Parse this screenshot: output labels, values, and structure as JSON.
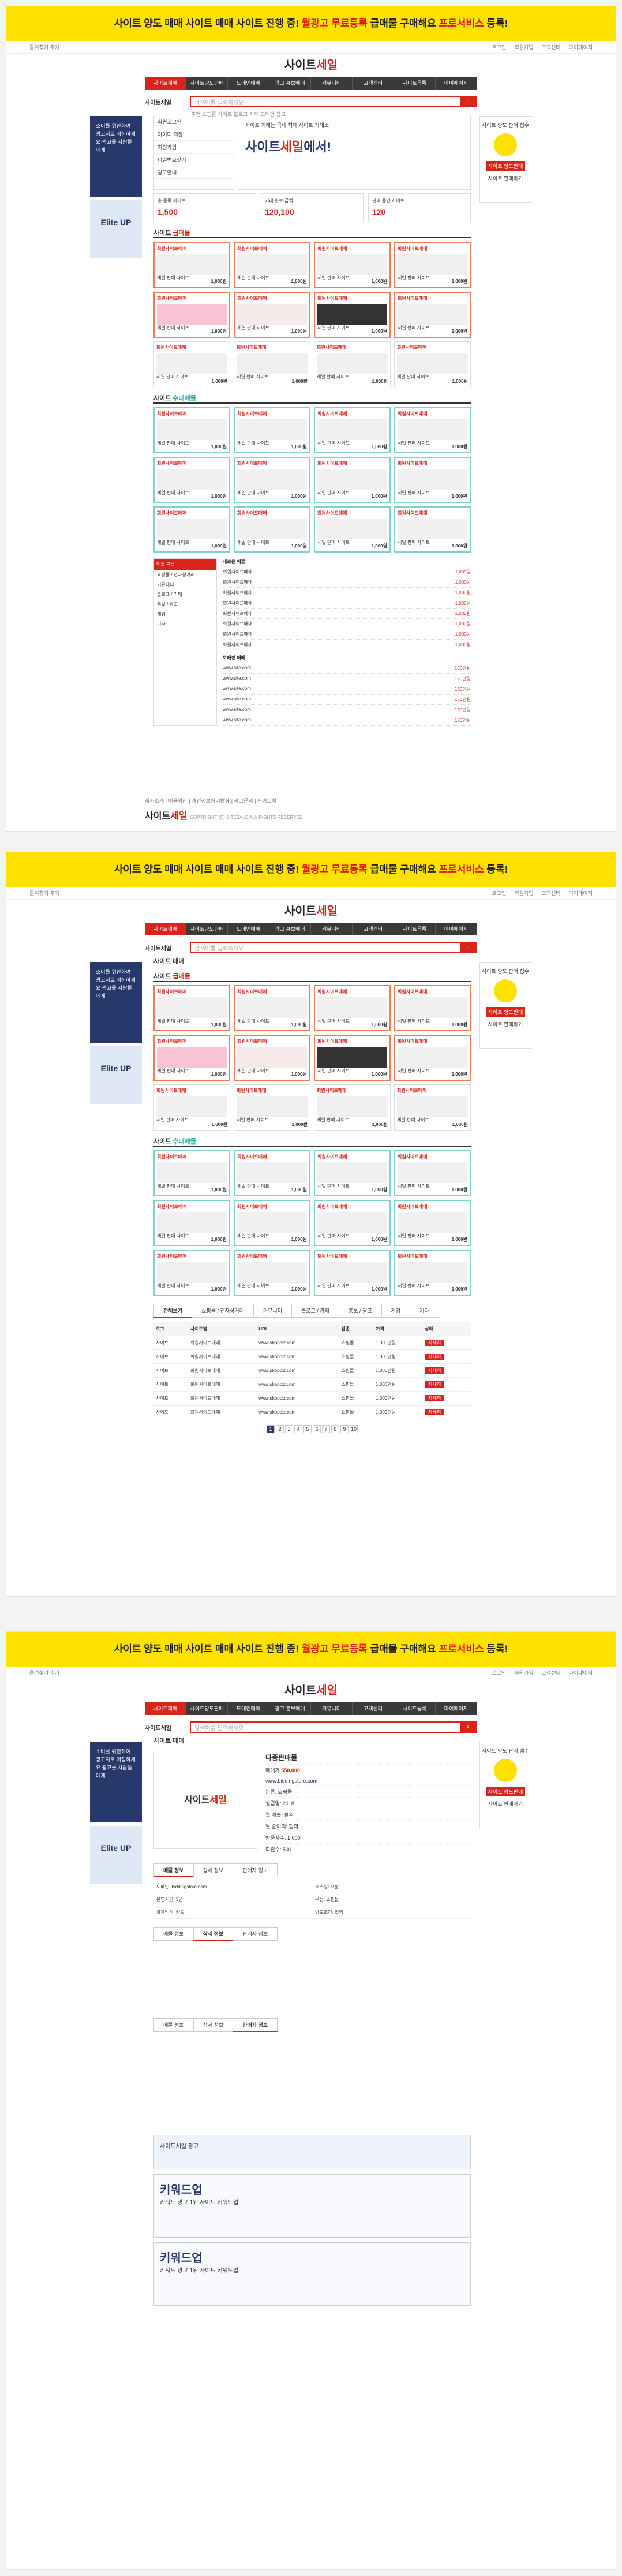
{
  "banner": {
    "text_a": "사이트 양도 매매 사이트 매매 사이트 진행 중! ",
    "text_b": "월광고 무료등록",
    "text_c": " 급매물 구매해요 ",
    "text_d": "프로서비스",
    "text_e": " 등록!"
  },
  "util": {
    "left": "즐겨찾기 추가",
    "links": [
      "로그인",
      "회원가입",
      "고객센터",
      "마이페이지"
    ]
  },
  "logo": {
    "a": "사이트",
    "b": "세일"
  },
  "nav": [
    "사이트매매",
    "사이트양도판매",
    "도메인매매",
    "광고 홍보매매",
    "커뮤니티",
    "고객센터",
    "사이트등록",
    "마이페이지"
  ],
  "search": {
    "label": "사이트세일",
    "placeholder": "검색어를 입력하세요",
    "keywords": "추천 쇼핑몰 사이트 블로그 카페 도메인 광고"
  },
  "left_ad": {
    "text": "소비를 위한하여 광고지로 매칭하세요 광고를 사람들에게",
    "brand": "Elite UP"
  },
  "right_ad": {
    "title": "사이트 양도 판매 접수",
    "highlight": "사이트 양도판매",
    "cta": "사이트 판매하기"
  },
  "hero": {
    "tabs": [
      "회원로그인",
      "아이디 저장",
      "회원가입",
      "비밀번호찾기",
      "광고안내"
    ],
    "big_a": "사이트",
    "big_b": "세일",
    "big_c": "에서!",
    "sub": "사이트 거래는 국내 최대 사이트 거래소"
  },
  "stats": [
    {
      "label": "총 등록 사이트",
      "value": "1,500"
    },
    {
      "label": "거래 완료 금액",
      "value": "120,100"
    },
    {
      "label": "판매 중인 사이트",
      "value": "120"
    }
  ],
  "sec1": {
    "title_a": "사이트 ",
    "title_b": "급매물",
    "more": "더보기 +"
  },
  "sec2": {
    "title_a": "사이트 ",
    "title_b": "추대매물",
    "more": "더보기 +"
  },
  "card": {
    "name": "회원사이트매매",
    "sub": "세일 판매 사이트",
    "price": "1,000원"
  },
  "list": {
    "title": "매물 분류",
    "items": [
      "쇼핑몰 / 전자상거래",
      "커뮤니티",
      "블로그 / 카페",
      "홍보 / 광고",
      "게임",
      "기타"
    ],
    "rows_title": "새로운 매물",
    "row_name": "회원사이트매매",
    "row_price": "1,000원",
    "domain_title": "도메인 매매",
    "domain_row": "www.site.com",
    "domain_price": "150만원",
    "kitchen_title": "쇼핑몰 등록"
  },
  "footer": {
    "links": [
      "회사소개",
      "이용약관",
      "개인정보처리방침",
      "광고문의",
      "사이트맵"
    ],
    "logo_a": "사이트",
    "logo_b": "세일",
    "copy": "COPYRIGHT (C) SITESALE ALL RIGHTS RESERVED"
  },
  "page2": {
    "path": "사이트 매매",
    "tabs": [
      "전체보기",
      "쇼핑몰 / 전자상거래",
      "커뮤니티",
      "블로그 / 카페",
      "홍보 / 광고",
      "게임",
      "기타"
    ],
    "headers": [
      "로고",
      "사이트명",
      "URL",
      "업종",
      "가격",
      "상태"
    ],
    "row": {
      "name": "회원사이트매매",
      "url": "www.shopbiz.com",
      "type": "쇼핑몰",
      "price": "1,000만원",
      "go": "자세히"
    },
    "pages": [
      "1",
      "2",
      "3",
      "4",
      "5",
      "6",
      "7",
      "8",
      "9",
      "10"
    ]
  },
  "page3": {
    "path": "사이트 매매",
    "title": "다중판매몰",
    "price_label": "매매가",
    "price": "550,000",
    "url": "www.biddingstore.com",
    "fields": [
      "분류: 쇼핑몰",
      "설립일: 2018",
      "월 매출: 협의",
      "월 순이익: 협의",
      "방문자수: 1,000",
      "회원수: 500"
    ],
    "tabs": [
      "매물 정보",
      "상세 정보",
      "판매자 정보"
    ],
    "specs": [
      "도메인: biddingstore.com",
      "호스팅: 포함",
      "운영기간: 3년",
      "구성: 쇼핑몰",
      "결제방식: 카드",
      "양도조건: 협의"
    ],
    "promo_text": "사이트세일 광고",
    "promo_kw": "키워드업",
    "promo_sub": "키워드 광고 1위 사이트 키워드업"
  }
}
